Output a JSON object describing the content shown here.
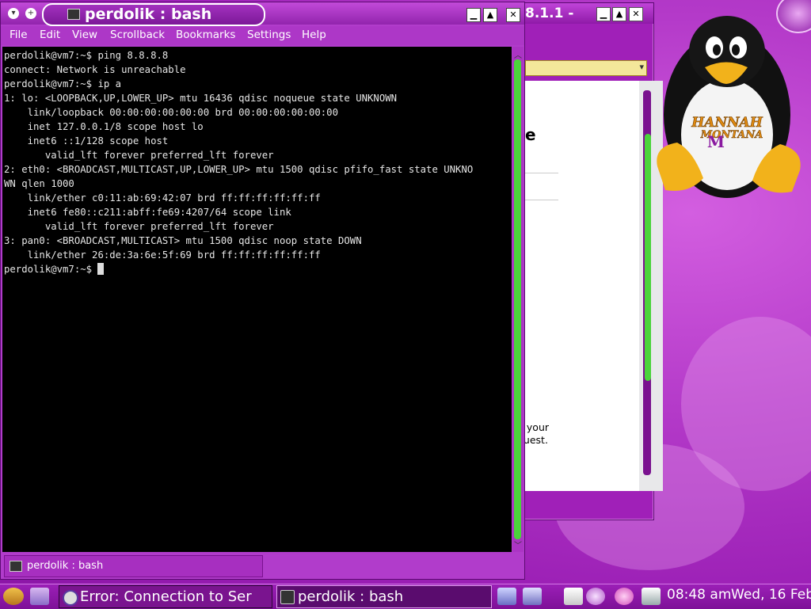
{
  "terminal": {
    "title": "perdolik : bash",
    "menu": [
      "File",
      "Edit",
      "View",
      "Scrollback",
      "Bookmarks",
      "Settings",
      "Help"
    ],
    "lines": [
      "perdolik@vm7:~$ ping 8.8.8.8",
      "connect: Network is unreachable",
      "perdolik@vm7:~$ ip a",
      "1: lo: <LOOPBACK,UP,LOWER_UP> mtu 16436 qdisc noqueue state UNKNOWN",
      "    link/loopback 00:00:00:00:00:00 brd 00:00:00:00:00:00",
      "    inet 127.0.0.1/8 scope host lo",
      "    inet6 ::1/128 scope host",
      "       valid_lft forever preferred_lft forever",
      "2: eth0: <BROADCAST,MULTICAST,UP,LOWER_UP> mtu 1500 qdisc pfifo_fast state UNKNO",
      "WN qlen 1000",
      "    link/ether c0:11:ab:69:42:07 brd ff:ff:ff:ff:ff:ff",
      "    inet6 fe80::c211:abff:fe69:4207/64 scope link",
      "       valid_lft forever preferred_lft forever",
      "3: pan0: <BROADCAST,MULTICAST> mtu 1500 qdisc noop state DOWN",
      "    link/ether 26:de:3a:6e:5f:69 brd ff:ff:ff:ff:ff:ff"
    ],
    "prompt": "perdolik@vm7:~$ ",
    "tab_label": "perdolik : bash"
  },
  "browser": {
    "title_fragment": "8.1.1 -",
    "heading_fragment": "e",
    "message_fragment_1": "g your",
    "message_fragment_2": "quest."
  },
  "taskbar": {
    "task1_label": "Error: Connection to Ser",
    "task2_label": "perdolik : bash",
    "clock": "08:48 am",
    "date": "Wed, 16 Feb"
  },
  "wallpaper": {
    "logo_line1": "HANNAH",
    "logo_line2": "MONTANA",
    "logo_initial": "M"
  },
  "colors": {
    "accent": "#a020b8",
    "scroll_thumb": "#4bd43b",
    "terminal_bg": "#000000"
  }
}
